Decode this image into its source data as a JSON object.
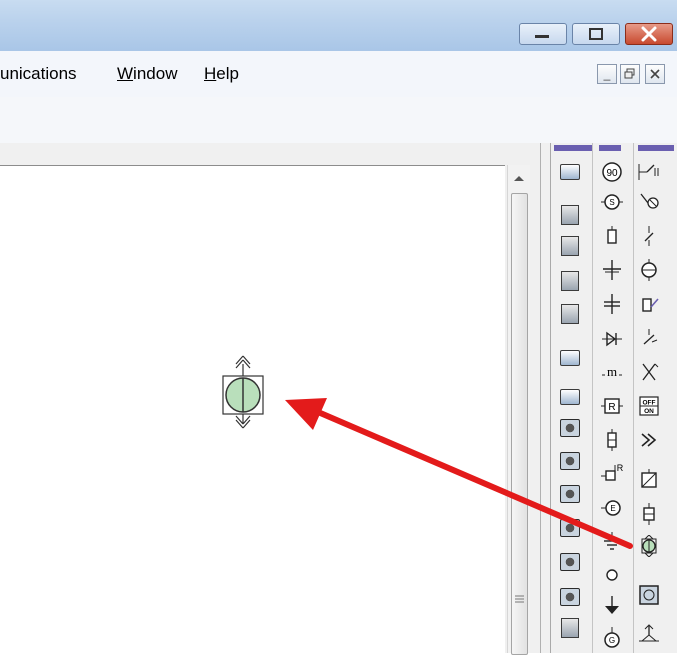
{
  "menubar": {
    "items": [
      {
        "label": "unications",
        "key": ""
      },
      {
        "label": "Window",
        "key": "W"
      },
      {
        "label": "Help",
        "key": "H"
      }
    ]
  },
  "window_controls": [
    "minimize",
    "maximize",
    "close"
  ],
  "mdi_controls": [
    "minimize",
    "restore",
    "close"
  ],
  "palette": {
    "col1": [
      "panel-meter-icon",
      "bar-indicator-icon",
      "panel-indicator-icon",
      "level-indicator-icon",
      "slider-indicator-icon",
      "gauge-icon",
      "gauge-icon",
      "dial-icon",
      "dial-icon",
      "dial-icon",
      "dial-icon",
      "dial-icon",
      "dial-icon",
      "dial-icon"
    ],
    "col2_labels": [
      "90",
      "S",
      "",
      "",
      "",
      "",
      "m",
      "R",
      "",
      "R",
      "E",
      "",
      "",
      "",
      "G"
    ],
    "col3_labels": [
      "",
      "",
      "",
      "",
      "",
      "",
      "",
      "OFF ON",
      "",
      "",
      "",
      "",
      "",
      ""
    ]
  },
  "colors": {
    "component_fill": "#b9dfbb",
    "arrow": "#e31b1b",
    "title_gradient": "#b9d1ec",
    "palette_tab": "#6a5fb0"
  }
}
